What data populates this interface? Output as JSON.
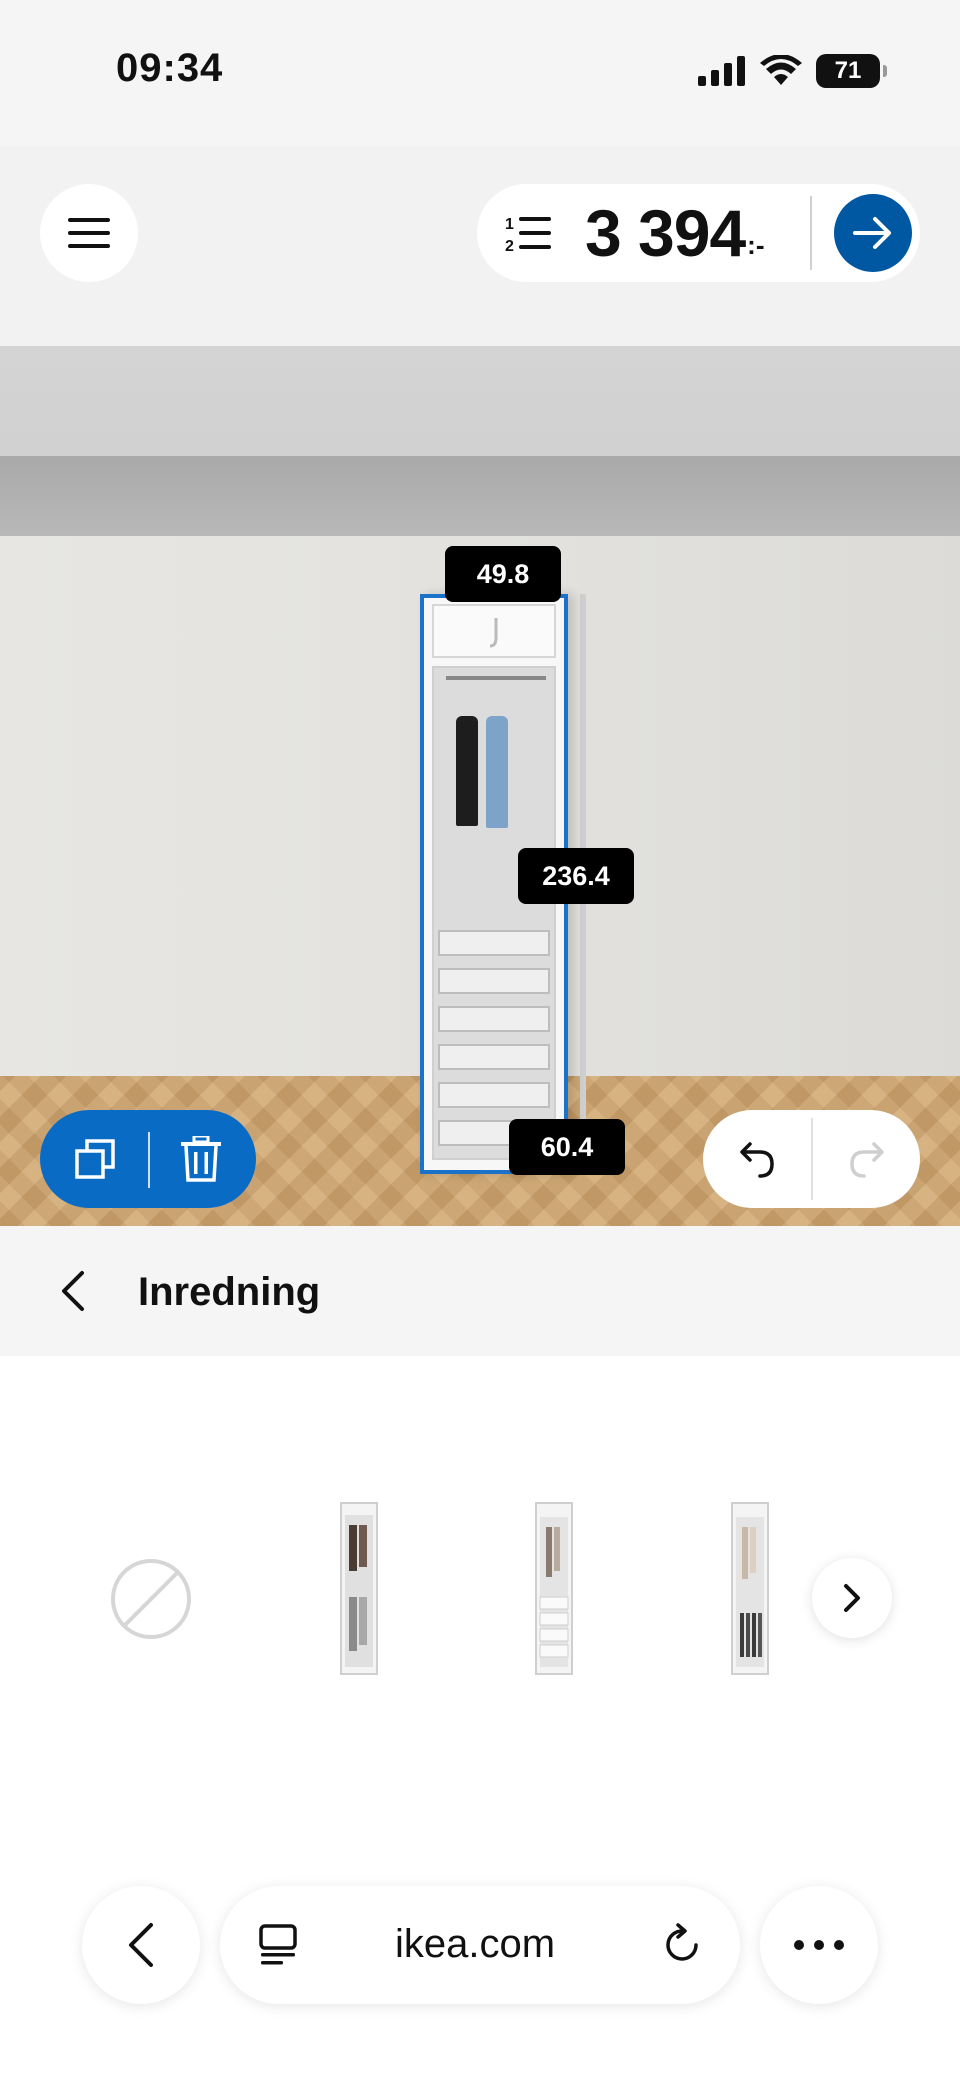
{
  "status_bar": {
    "time": "09:34",
    "battery": "71"
  },
  "header": {
    "price": "3 394",
    "price_suffix": ":-"
  },
  "dimensions": {
    "width_top": "49.8",
    "height": "236.4",
    "depth": "60.4"
  },
  "section": {
    "title": "Inredning"
  },
  "options": {
    "items": [
      {
        "name": "none"
      },
      {
        "name": "option-1"
      },
      {
        "name": "option-2"
      },
      {
        "name": "option-3"
      }
    ]
  },
  "browser": {
    "url": "ikea.com"
  },
  "colors": {
    "accent": "#0058a3",
    "selection": "#1a73c9",
    "edit_pill": "#0a6bc5"
  },
  "icons": [
    "menu-icon",
    "list-icon",
    "arrow-right-icon",
    "duplicate-icon",
    "trash-icon",
    "undo-icon",
    "redo-icon",
    "chevron-left-icon",
    "no-selection-icon",
    "chevron-right-icon",
    "tabs-icon",
    "reload-icon",
    "more-icon"
  ]
}
